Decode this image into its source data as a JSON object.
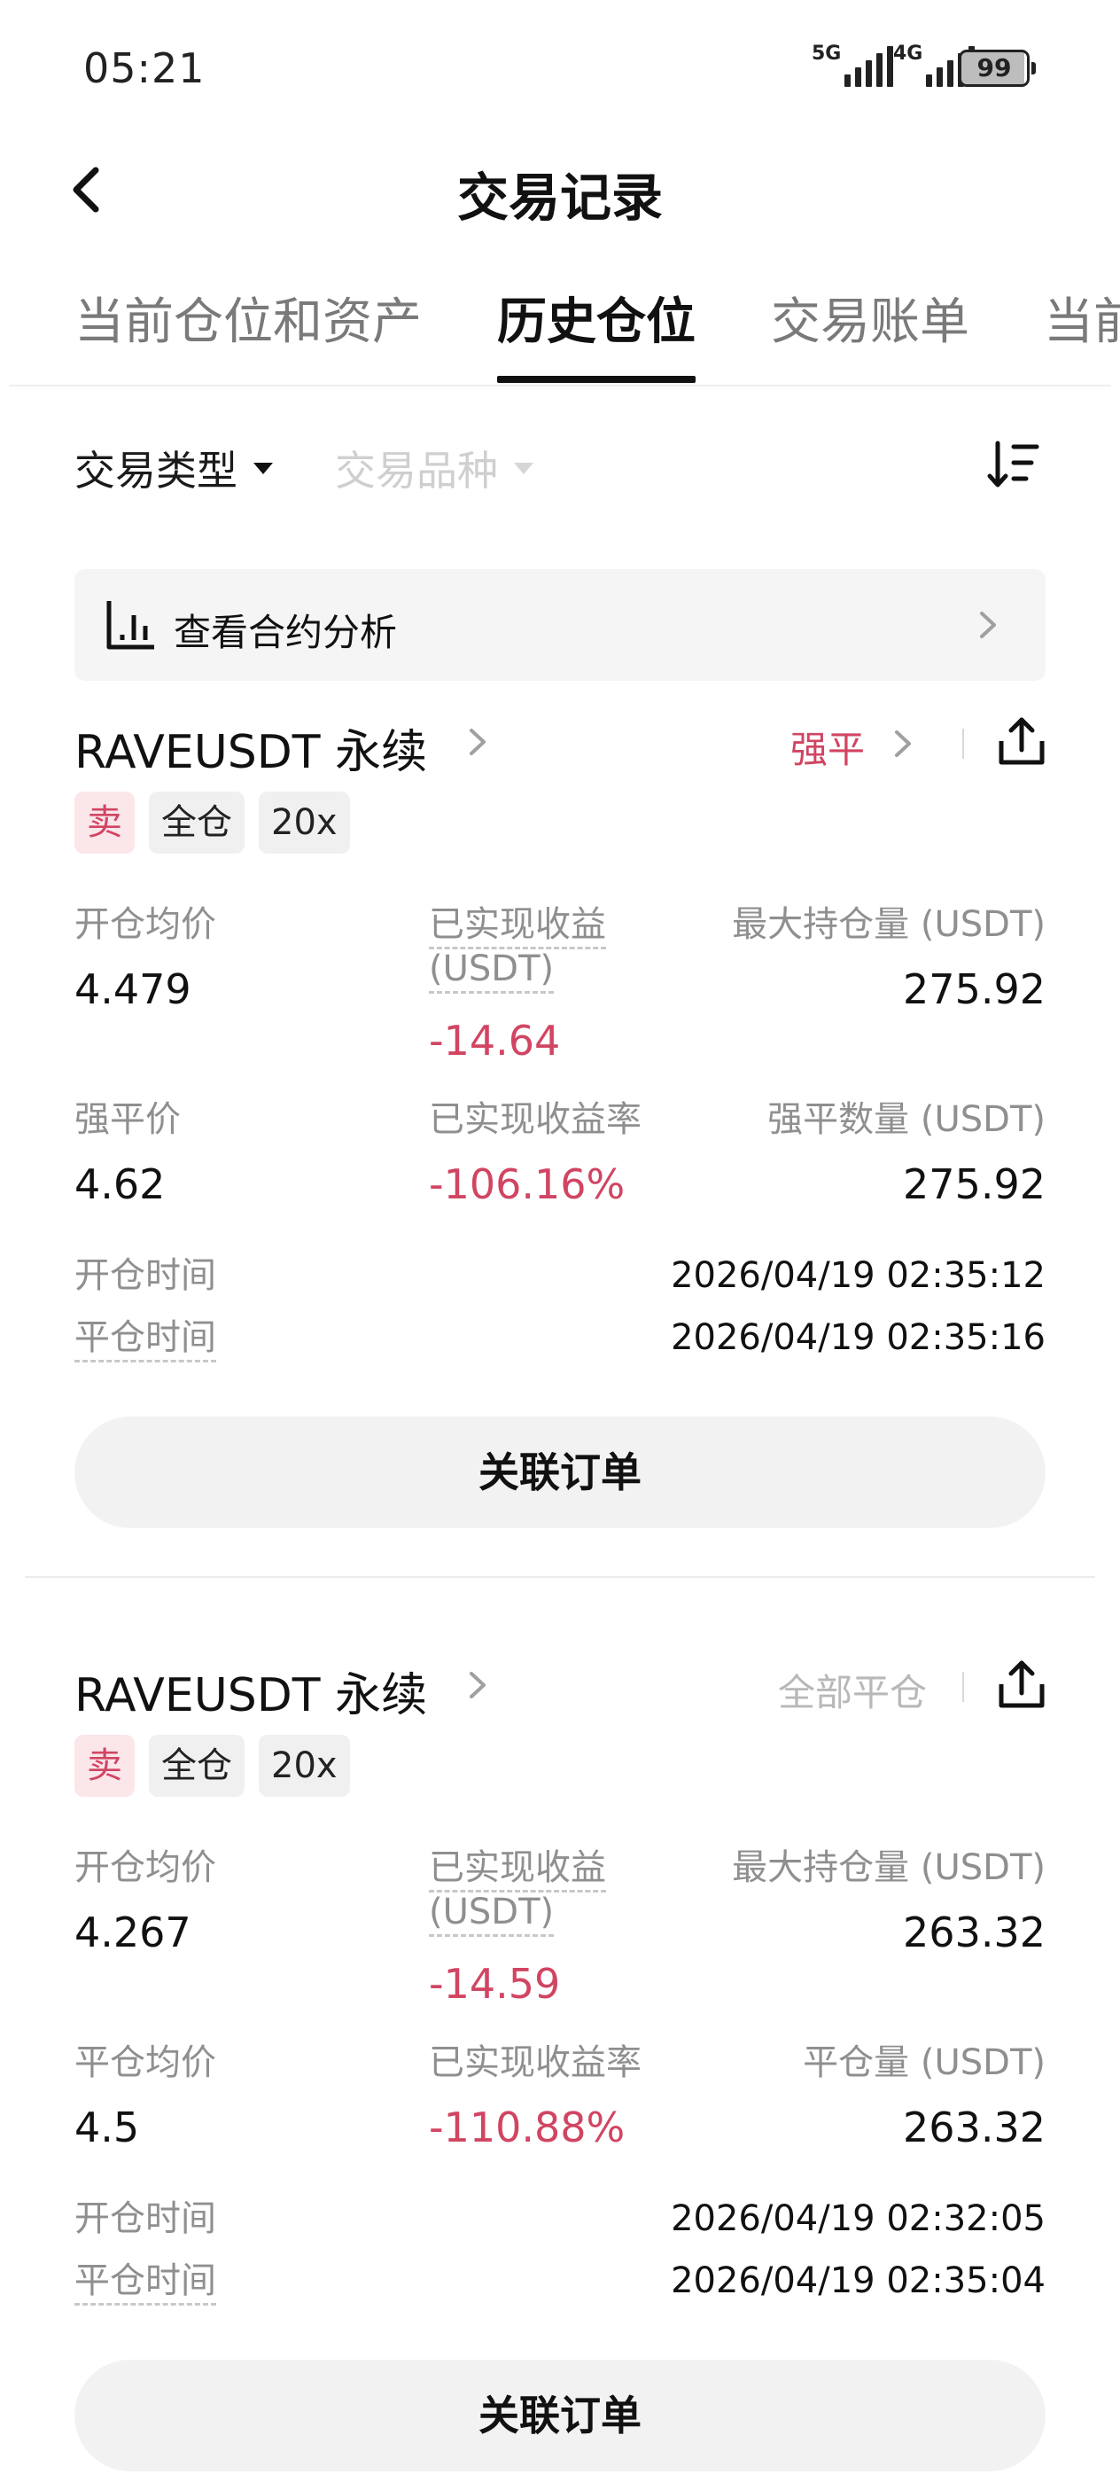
{
  "status_bar": {
    "time": "05:21",
    "network1": "5G",
    "network2": "4G",
    "battery": "99"
  },
  "header": {
    "title": "交易记录",
    "back_icon": "chevron-left-icon"
  },
  "tabs": [
    {
      "label": "当前仓位和资产",
      "active": false
    },
    {
      "label": "历史仓位",
      "active": true
    },
    {
      "label": "交易账单",
      "active": false
    },
    {
      "label": "当前委托",
      "active": false
    }
  ],
  "filters": {
    "trade_type": "交易类型",
    "trade_symbol": "交易品种"
  },
  "banner": {
    "label": "查看合约分析"
  },
  "colors": {
    "accent_red": "#d14562",
    "muted_gray": "#8f8f8f"
  },
  "positions": [
    {
      "symbol": "RAVEUSDT 永续",
      "status": "强平",
      "badges": [
        "卖",
        "全仓",
        "20x"
      ],
      "avg_open_label": "开仓均价",
      "avg_open": "4.479",
      "pnl_label": "已实现收益",
      "pnl_unit": "(USDT)",
      "pnl": "-14.64",
      "max_pos_label": "最大持仓量 (USDT)",
      "max_pos": "275.92",
      "second_price_label": "强平价",
      "second_price": "4.62",
      "pnl_rate_label": "已实现收益率",
      "pnl_rate": "-106.16%",
      "close_qty_label": "强平数量 (USDT)",
      "close_qty": "275.92",
      "open_time_label": "开仓时间",
      "open_time": "2026/04/19 02:35:12",
      "close_time_label": "平仓时间",
      "close_time": "2026/04/19 02:35:16",
      "button": "关联订单"
    },
    {
      "symbol": "RAVEUSDT 永续",
      "status": "全部平仓",
      "badges": [
        "卖",
        "全仓",
        "20x"
      ],
      "avg_open_label": "开仓均价",
      "avg_open": "4.267",
      "pnl_label": "已实现收益",
      "pnl_unit": "(USDT)",
      "pnl": "-14.59",
      "max_pos_label": "最大持仓量 (USDT)",
      "max_pos": "263.32",
      "second_price_label": "平仓均价",
      "second_price": "4.5",
      "pnl_rate_label": "已实现收益率",
      "pnl_rate": "-110.88%",
      "close_qty_label": "平仓量 (USDT)",
      "close_qty": "263.32",
      "open_time_label": "开仓时间",
      "open_time": "2026/04/19 02:32:05",
      "close_time_label": "平仓时间",
      "close_time": "2026/04/19 02:35:04",
      "button": "关联订单"
    }
  ]
}
